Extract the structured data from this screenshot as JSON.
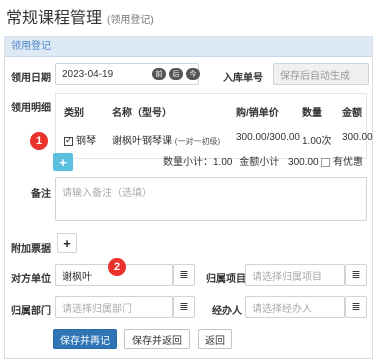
{
  "header": {
    "title": "常规课程管理",
    "subtitle": "(领用登记)"
  },
  "panel": {
    "title": "领用登记"
  },
  "form": {
    "date_label": "领用日期",
    "date_value": "2023-04-19",
    "date_buttons": [
      "前",
      "后",
      "今"
    ],
    "stock_no_label": "入库单号",
    "stock_no_placeholder": "保存后自动生成",
    "detail_label": "领用明细",
    "notes_label": "备注",
    "notes_placeholder": "请输入备注（选填）",
    "attach_label": "附加票据",
    "party_label": "对方单位",
    "party_value": "谢枫叶",
    "project_label": "归属项目",
    "project_placeholder": "请选择归属项目",
    "dept_label": "归属部门",
    "dept_placeholder": "请选择归属部门",
    "handler_label": "经办人",
    "handler_placeholder": "请选择经办人"
  },
  "table": {
    "columns": [
      "类别",
      "名称（型号）",
      "购/销单价",
      "数量",
      "金额"
    ],
    "rows": [
      {
        "category": "钢琴",
        "name": "谢枫叶钢琴课",
        "model": "(一对一初级)",
        "price": "300.00/300.00",
        "qty": "1.00次",
        "amount": "300.00"
      }
    ]
  },
  "summary": {
    "qty_label": "数量小计：",
    "qty_value": "1.00",
    "amount_label": "金额小计",
    "amount_value": "300.00",
    "discount_label": "有优惠"
  },
  "annotations": [
    "1",
    "2"
  ],
  "buttons": {
    "save_again": "保存并再记",
    "save_return": "保存并返回",
    "back": "返回"
  },
  "icons": {
    "add": "+",
    "list": "≣"
  },
  "colors": {
    "primary": "#2f75b5",
    "add_button": "#5bc0de",
    "badge": "#e8322b",
    "panel_head": "#dde9f5"
  }
}
